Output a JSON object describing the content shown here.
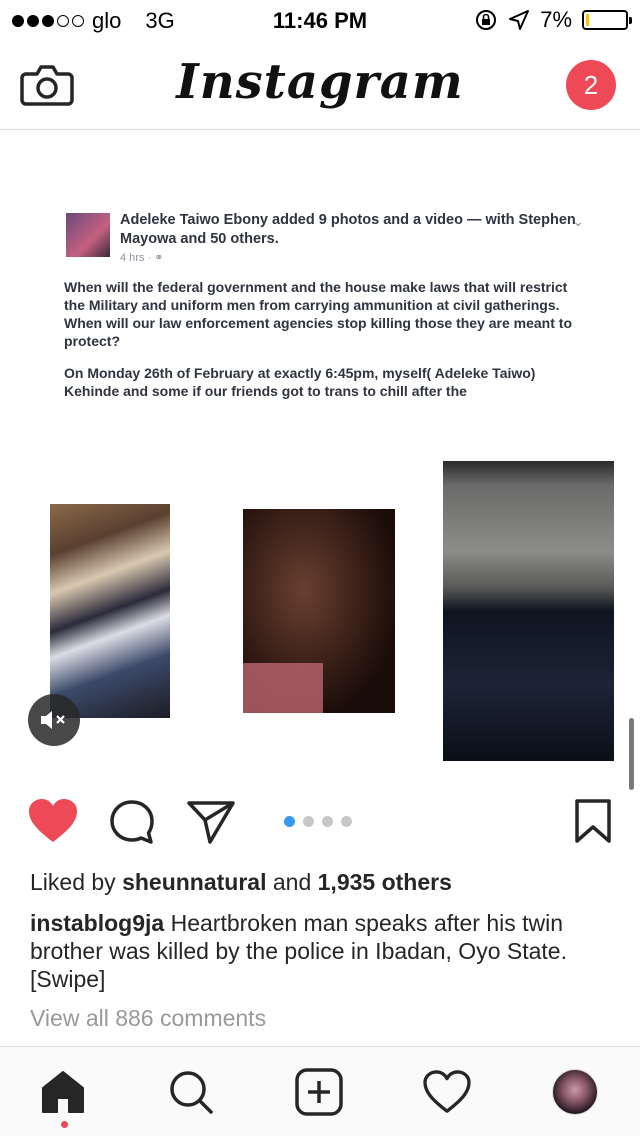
{
  "status_bar": {
    "carrier": "glo",
    "network": "3G",
    "time": "11:46 PM",
    "battery_percent": "7%",
    "battery_level": 0.07,
    "signal_dots_filled": 3,
    "signal_dots_total": 5
  },
  "header": {
    "logo": "Instagram",
    "notification_count": "2"
  },
  "post": {
    "screenshot_text": {
      "author_line": "Adeleke Taiwo Ebony added 9 photos and a video — with Stephen Mayowa and 50 others.",
      "timestamp": "4 hrs · ",
      "paragraph_1": "When will the federal government and the house make laws that will restrict the Military and uniform men from carrying ammunition at civil gatherings. When will our law enforcement agencies stop killing those they are meant to protect?",
      "paragraph_2": "On Monday 26th of February at exactly 6:45pm, myself( Adeleke Taiwo) Kehinde and some if our friends got to trans to chill after the"
    },
    "carousel_pages": 4,
    "carousel_active_index": 0,
    "liked": true,
    "likes": {
      "prefix": "Liked by ",
      "user": "sheunnatural",
      "middle": " and ",
      "others": "1,935 others"
    },
    "caption": {
      "username": "instablog9ja",
      "text": " Heartbroken man speaks after his twin brother was killed by the police in Ibadan, Oyo State. [Swipe]"
    },
    "view_comments": "View all 886 comments"
  },
  "colors": {
    "like_red": "#ed4956",
    "carousel_active": "#3897f0",
    "battery_yellow": "#f5c400"
  },
  "icons": {
    "header_left": "camera-icon",
    "tabs": [
      "home-icon",
      "search-icon",
      "add-icon",
      "heart-outline-icon",
      "profile-avatar"
    ],
    "actions": [
      "heart-filled-icon",
      "comment-icon",
      "share-icon",
      "bookmark-icon"
    ]
  }
}
